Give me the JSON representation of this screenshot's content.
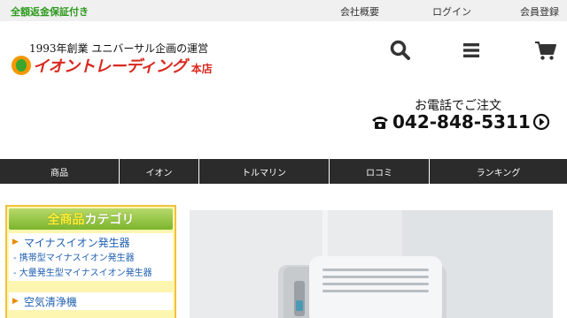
{
  "topbar": {
    "guarantee": "全額返金保証付き",
    "links": [
      "会社概要",
      "ログイン",
      "会員登録"
    ]
  },
  "header": {
    "tagline": "1993年創業 ユニバーサル企画の運営",
    "logo_text": "イオントレーディング",
    "logo_sub": "本店",
    "icons": [
      "search-icon",
      "menu-icon",
      "cart-icon"
    ],
    "order_label": "お電話でご注文",
    "phone_number": "042-848-5311"
  },
  "nav": {
    "items": [
      "商品",
      "イオン",
      "トルマリン",
      "ロコミ",
      "ランキング"
    ]
  },
  "category": {
    "heading_accent": "全商品",
    "heading_rest": "カテゴリ",
    "items": [
      {
        "label": "マイナスイオン発生器",
        "sub": [
          "- 携帯型マイナスイオン発生器",
          "- 大量発生型マイナスイオン発生器"
        ]
      },
      {
        "label": "空気清浄機",
        "sub": []
      }
    ]
  },
  "colors": {
    "guarantee_green": "#2d9a1e",
    "logo_red": "#d8281e",
    "nav_bg": "#2b2b2b",
    "category_bg": "#fdf6b0",
    "link_blue": "#1f5fb0"
  }
}
